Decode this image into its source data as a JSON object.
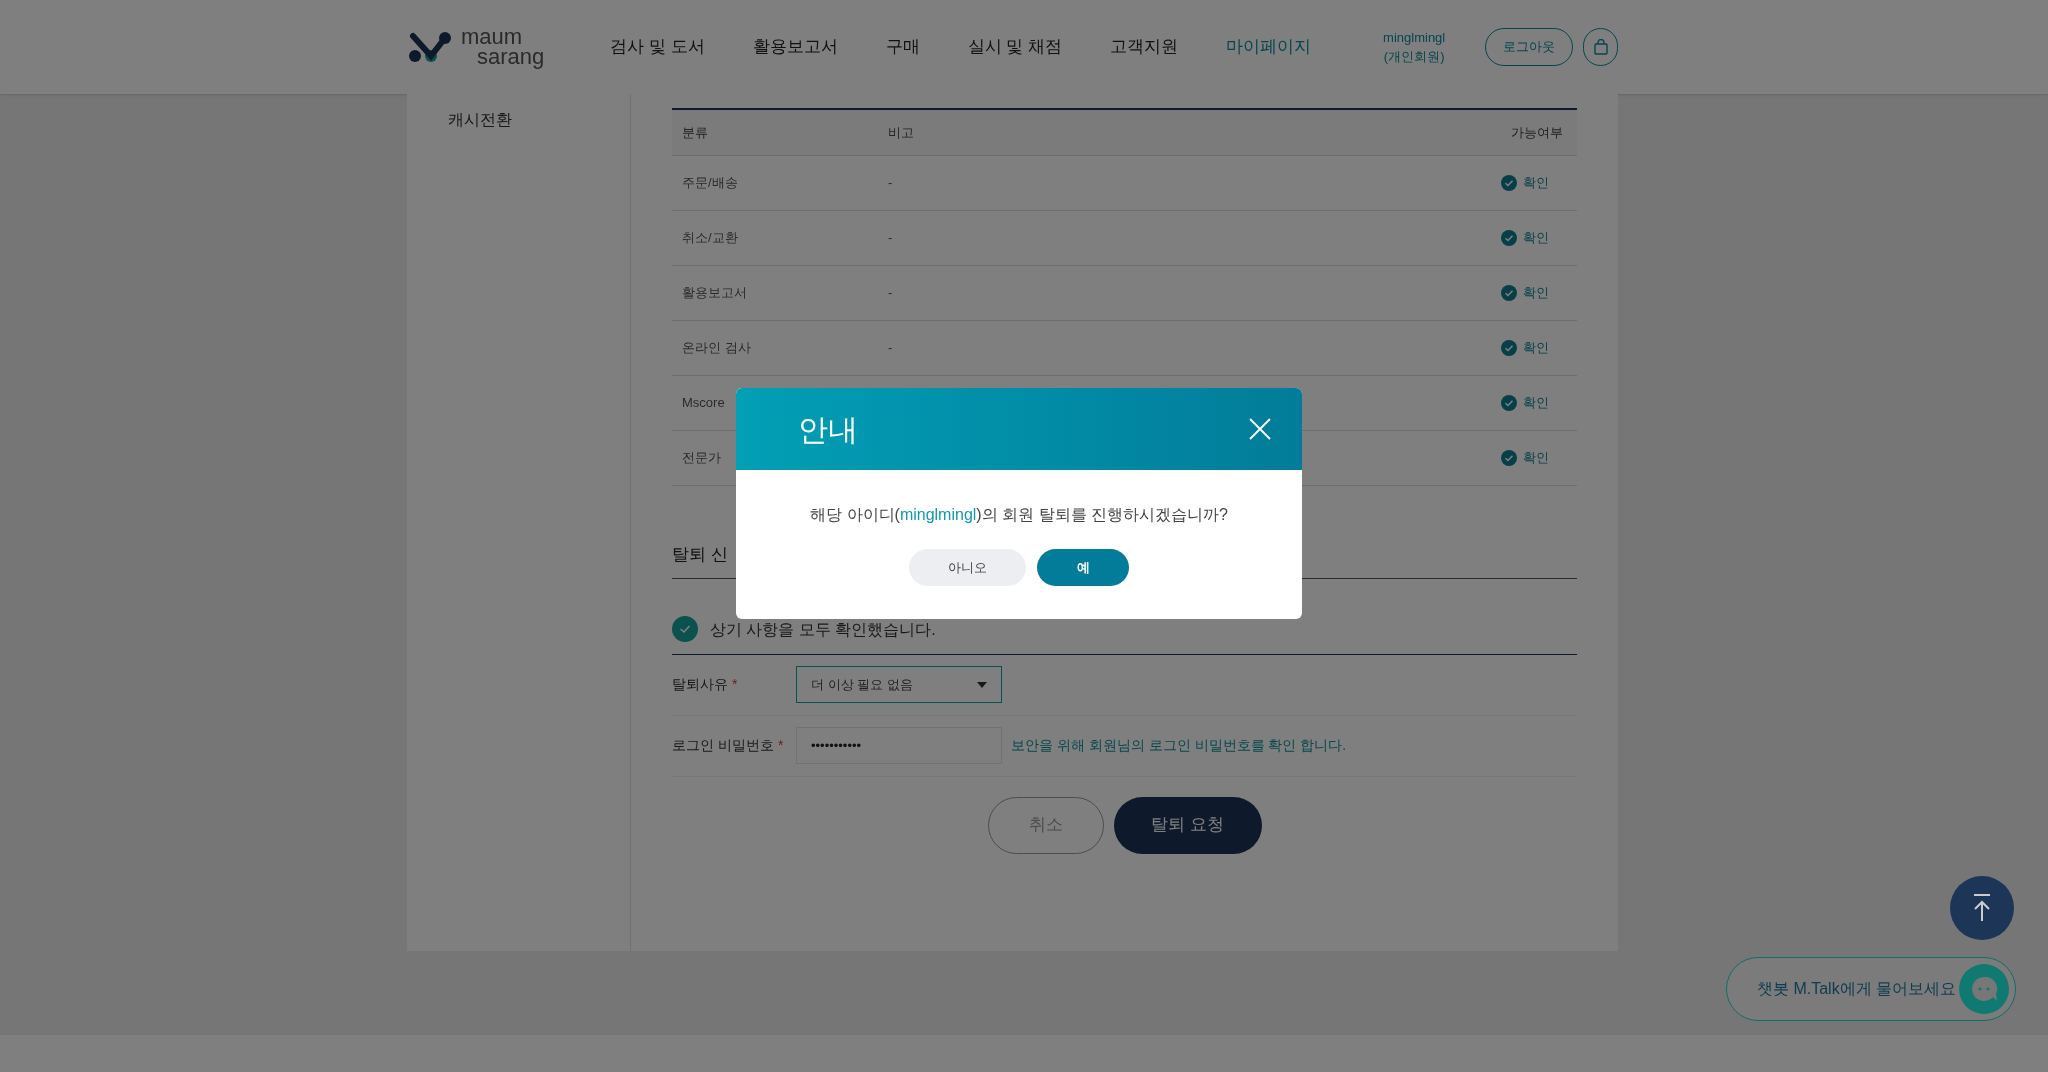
{
  "header": {
    "logo": {
      "line1": "maum",
      "line2": "sarang"
    },
    "nav": [
      {
        "label": "검사 및 도서",
        "selected": false
      },
      {
        "label": "활용보고서",
        "selected": false
      },
      {
        "label": "구매",
        "selected": false
      },
      {
        "label": "실시 및 채점",
        "selected": false
      },
      {
        "label": "고객지원",
        "selected": false
      },
      {
        "label": "마이페이지",
        "selected": true
      }
    ],
    "user": {
      "name": "minglmingl",
      "type": "(개인회원)"
    },
    "logout": "로그아웃"
  },
  "sidebar": {
    "items": [
      {
        "label": "캐시전환"
      }
    ]
  },
  "table": {
    "columns": [
      "분류",
      "비고",
      "가능여부"
    ],
    "rows": [
      {
        "category": "주문/배송",
        "note": "-",
        "status": "확인"
      },
      {
        "category": "취소/교환",
        "note": "-",
        "status": "확인"
      },
      {
        "category": "활용보고서",
        "note": "-",
        "status": "확인"
      },
      {
        "category": "온라인 검사",
        "note": "-",
        "status": "확인"
      },
      {
        "category": "Mscore",
        "note": "",
        "status": "확인"
      },
      {
        "category": "전문가",
        "note": "",
        "status": "확인"
      }
    ]
  },
  "withdrawal": {
    "title": "탈퇴 신",
    "confirm": {
      "label": "상기 사항을 모두 확인했습니다.",
      "checked": true
    },
    "fields": [
      {
        "kind": "select",
        "label": "탈퇴사유",
        "required_mark": "*",
        "value": "더 이상 필요 없음"
      },
      {
        "kind": "password",
        "label": "로그인 비밀번호",
        "required_mark": "*",
        "value": "•••••••••••",
        "hint": "보안을 위해 회원님의 로그인 비밀번호를 확인 합니다."
      }
    ],
    "buttons": [
      {
        "label": "취소",
        "primary": false
      },
      {
        "label": "탈퇴 요청",
        "primary": true
      }
    ]
  },
  "modal": {
    "title": "안내",
    "message_before": "해당 아이디(",
    "user_id": "minglmingl",
    "message_after": ")의 회원 탈퇴를 진행하시겠습니까?",
    "buttons": [
      {
        "label": "아니오",
        "primary": false
      },
      {
        "label": "예",
        "primary": true
      }
    ]
  },
  "chatbot": {
    "label": "챗봇 M.Talk에게 물어보세요"
  }
}
